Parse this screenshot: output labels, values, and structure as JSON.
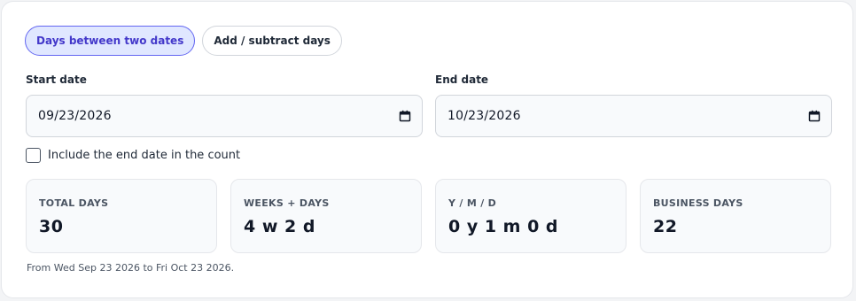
{
  "tabs": [
    {
      "label": "Days between two dates",
      "active": true
    },
    {
      "label": "Add / subtract days",
      "active": false
    }
  ],
  "start": {
    "label": "Start date",
    "value": "09/23/2026",
    "icon": "calendar-icon"
  },
  "end": {
    "label": "End date",
    "value": "10/23/2026",
    "icon": "calendar-icon"
  },
  "include_end": {
    "label": "Include the end date in the count",
    "checked": false
  },
  "stats": [
    {
      "label": "TOTAL DAYS",
      "value": "30"
    },
    {
      "label": "WEEKS + DAYS",
      "value": "4 w 2 d"
    },
    {
      "label": "Y / M / D",
      "value": "0 y 1 m 0 d"
    },
    {
      "label": "BUSINESS DAYS",
      "value": "22"
    }
  ],
  "summary": "From Wed Sep 23 2026 to Fri Oct 23 2026.",
  "colors": {
    "accent": "#4338ca",
    "accent_bg": "#e0e7ff",
    "card_bg": "#f8fafc"
  }
}
